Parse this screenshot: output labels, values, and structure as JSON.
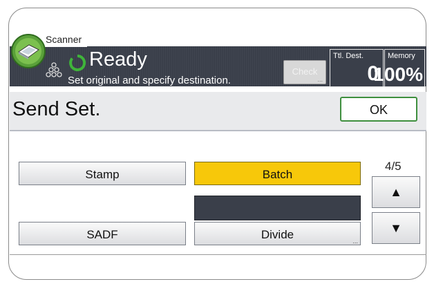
{
  "app": {
    "name": "Scanner"
  },
  "status": {
    "state": "Ready",
    "message": "Set original and specify destination.",
    "check_button": {
      "label": "Check",
      "more": "..."
    },
    "total_destinations": {
      "label": "Ttl. Dest.",
      "value": "0"
    },
    "memory": {
      "label": "Memory",
      "value": "100%"
    }
  },
  "header": {
    "title": "Send Set.",
    "ok_label": "OK"
  },
  "options": {
    "stamp": {
      "label": "Stamp"
    },
    "batch": {
      "label": "Batch",
      "selected": true
    },
    "sadf": {
      "label": "SADF"
    },
    "divide": {
      "label": "Divide",
      "more": "..."
    }
  },
  "pagination": {
    "indicator": "4/5",
    "up_glyph": "▲",
    "down_glyph": "▼"
  },
  "icons": [
    "scanner-icon",
    "ready-icon",
    "originals-stack-icon",
    "up-arrow-icon",
    "down-arrow-icon"
  ],
  "colors": {
    "header_bg": "#3a3f4a",
    "selected": "#f7c80a",
    "ok_border": "#3e8f3e",
    "ready_green": "#3fb43a"
  }
}
